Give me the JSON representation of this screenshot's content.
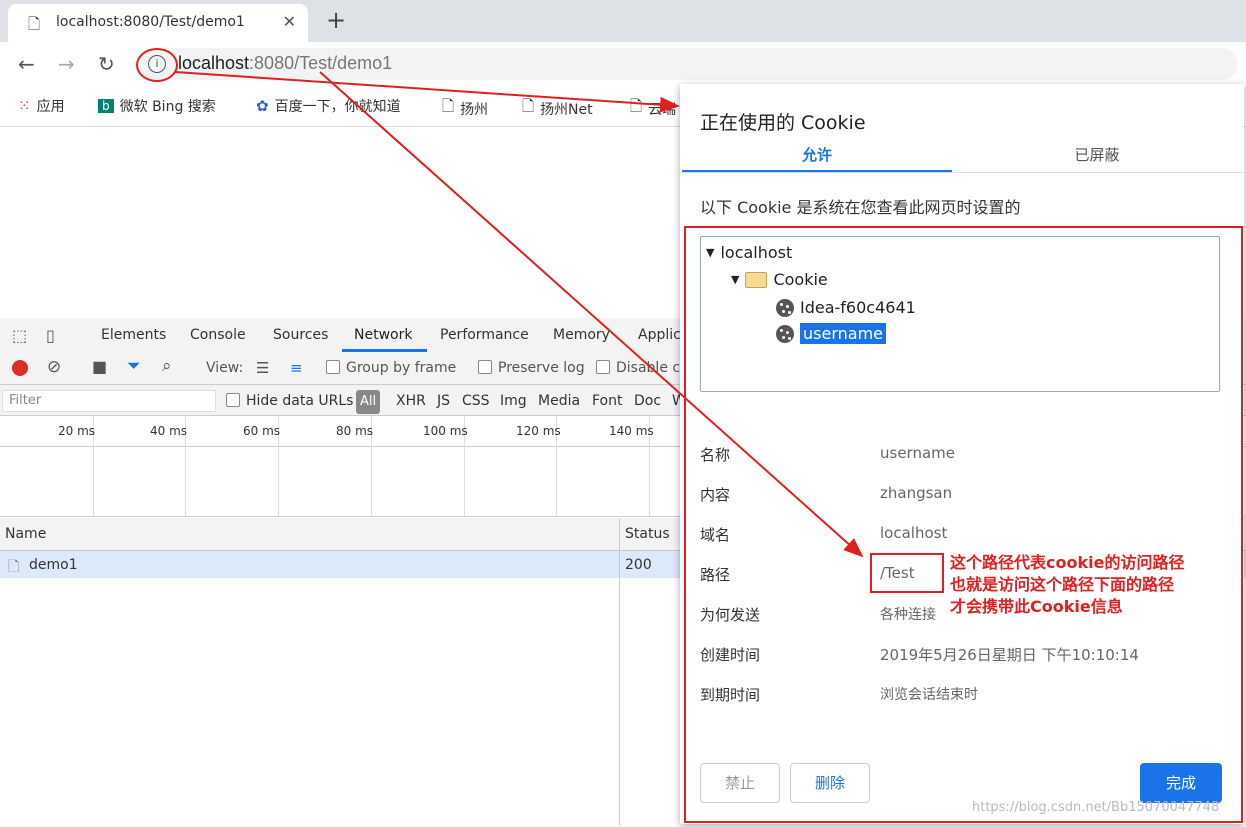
{
  "browser": {
    "tab_title": "localhost:8080/Test/demo1",
    "new_tab": "+",
    "url_host": "localhost",
    "url_rest": ":8080/Test/demo1",
    "info_icon": "i"
  },
  "bookmarks": [
    {
      "icon": "apps-icon",
      "label": "应用"
    },
    {
      "icon": "bing-icon",
      "label": "微软 Bing 搜索"
    },
    {
      "icon": "baidu-icon",
      "label": "百度一下，你就知道"
    },
    {
      "icon": "page-icon",
      "label": "扬州"
    },
    {
      "icon": "page-icon",
      "label": "扬州Net"
    },
    {
      "icon": "page-icon",
      "label": "云瑞"
    }
  ],
  "devtools": {
    "tabs": [
      "Elements",
      "Console",
      "Sources",
      "Network",
      "Performance",
      "Memory",
      "Applic"
    ],
    "toolbar": {
      "view_label": "View:",
      "group_by_frame": "Group by frame",
      "preserve_log": "Preserve log",
      "disable_cache": "Disable ca"
    },
    "filter": {
      "placeholder": "Filter",
      "hide_data_urls": "Hide data URLs",
      "types": [
        "All",
        "XHR",
        "JS",
        "CSS",
        "Img",
        "Media",
        "Font",
        "Doc",
        "W"
      ]
    },
    "timeline_ticks": [
      "20 ms",
      "40 ms",
      "60 ms",
      "80 ms",
      "100 ms",
      "120 ms",
      "140 ms"
    ],
    "table": {
      "headers": [
        "Name",
        "Status"
      ],
      "rows": [
        {
          "name": "demo1",
          "status": "200"
        }
      ]
    }
  },
  "dialog": {
    "title": "正在使用的 Cookie",
    "tabs": [
      "允许",
      "已屏蔽"
    ],
    "description": "以下 Cookie 是系统在您查看此网页时设置的",
    "tree": {
      "host": "localhost",
      "folder": "Cookie",
      "items": [
        "Idea-f60c4641",
        "username"
      ]
    },
    "details": [
      {
        "key": "名称",
        "value": "username"
      },
      {
        "key": "内容",
        "value": "zhangsan"
      },
      {
        "key": "域名",
        "value": "localhost"
      },
      {
        "key": "路径",
        "value": "/Test"
      },
      {
        "key": "为何发送",
        "value": "各种连接"
      },
      {
        "key": "创建时间",
        "value": "2019年5月26日星期日 下午10:10:14"
      },
      {
        "key": "到期时间",
        "value": "浏览会话结束时"
      }
    ],
    "buttons": {
      "block": "禁止",
      "delete": "删除",
      "done": "完成"
    }
  },
  "annotation": {
    "note": "这个路径代表cookie的访问路径\n也就是访问这个路径下面的路径\n才会携带此Cookie信息",
    "color": "#e02020"
  },
  "watermark": "https://blog.csdn.net/Bb15070047748"
}
